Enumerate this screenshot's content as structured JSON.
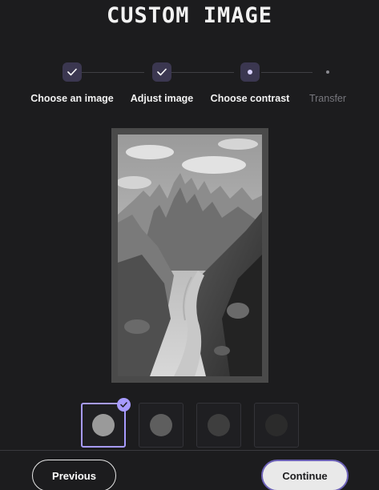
{
  "title": "CUSTOM IMAGE",
  "stepper": {
    "steps": [
      {
        "label": "Choose an image",
        "state": "complete",
        "icon": "check-icon"
      },
      {
        "label": "Adjust image",
        "state": "complete",
        "icon": "check-icon"
      },
      {
        "label": "Choose contrast",
        "state": "active",
        "icon": "dot-icon"
      },
      {
        "label": "Transfer",
        "state": "upcoming",
        "icon": "dot-icon"
      }
    ]
  },
  "preview": {
    "alt": "Mountain trail photo preview in grayscale"
  },
  "contrast": {
    "options": [
      {
        "level": "light",
        "color": "#9a9a9a",
        "selected": true
      },
      {
        "level": "medium",
        "color": "#5e5e5e",
        "selected": false
      },
      {
        "level": "dark",
        "color": "#3e3e3e",
        "selected": false
      },
      {
        "level": "darkest",
        "color": "#2b2b2b",
        "selected": false
      }
    ]
  },
  "footer": {
    "previous_label": "Previous",
    "continue_label": "Continue"
  },
  "colors": {
    "background": "#1c1c1e",
    "accent": "#a79bff",
    "step_bg": "#3b3750"
  }
}
